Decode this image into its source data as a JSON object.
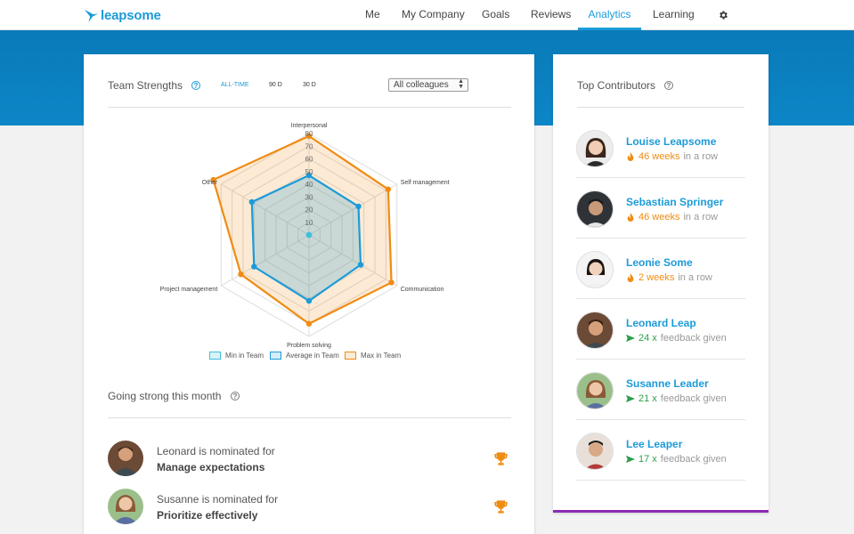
{
  "nav": {
    "logo": "leapsome",
    "items": [
      "Me",
      "My Company",
      "Goals",
      "Reviews",
      "Analytics",
      "Learning"
    ],
    "active": "Analytics",
    "settings_icon": "gear-icon"
  },
  "team_strengths": {
    "title": "Team Strengths",
    "filters": [
      "ALL-TIME",
      "90 D",
      "30 D"
    ],
    "active_filter": "ALL-TIME",
    "select_value": "All colleagues",
    "chart_data": {
      "type": "radar",
      "axes": [
        "Interpersonal",
        "Self management",
        "Communication",
        "Problem solving",
        "Project management",
        "Other"
      ],
      "scale_ticks": [
        "10",
        "20",
        "30",
        "40",
        "50",
        "60",
        "70",
        "80"
      ],
      "range": [
        0,
        80
      ],
      "series": [
        {
          "name": "Min in Team",
          "values": [
            0,
            0,
            0,
            0,
            0,
            0
          ],
          "color": "#3fc0dc"
        },
        {
          "name": "Average in Team",
          "values": [
            47,
            45,
            47,
            52,
            50,
            52
          ],
          "color": "#1c9bd8"
        },
        {
          "name": "Max in Team",
          "values": [
            78,
            72,
            75,
            70,
            62,
            87
          ],
          "color": "#ef8c14"
        }
      ]
    }
  },
  "going_strong": {
    "title": "Going strong this month",
    "nominees": [
      {
        "text": "Leonard is nominated for",
        "skill": "Manage expectations"
      },
      {
        "text": "Susanne is nominated for",
        "skill": "Prioritize effectively"
      }
    ]
  },
  "top_contributors": {
    "title": "Top Contributors",
    "people": [
      {
        "name": "Louise Leapsome",
        "value": "46 weeks",
        "suffix": "in a row",
        "kind": "streak"
      },
      {
        "name": "Sebastian Springer",
        "value": "46 weeks",
        "suffix": "in a row",
        "kind": "streak"
      },
      {
        "name": "Leonie Some",
        "value": "2 weeks",
        "suffix": "in a row",
        "kind": "streak"
      },
      {
        "name": "Leonard Leap",
        "value": "24 x",
        "suffix": "feedback given",
        "kind": "feedback"
      },
      {
        "name": "Susanne Leader",
        "value": "21 x",
        "suffix": "feedback given",
        "kind": "feedback"
      },
      {
        "name": "Lee Leaper",
        "value": "17 x",
        "suffix": "feedback given",
        "kind": "feedback"
      }
    ]
  },
  "colors": {
    "brand": "#1c9bd8",
    "streak": "#ef8c14",
    "feedback": "#2e9e4a",
    "accent_bar": "#8b2bb5"
  }
}
